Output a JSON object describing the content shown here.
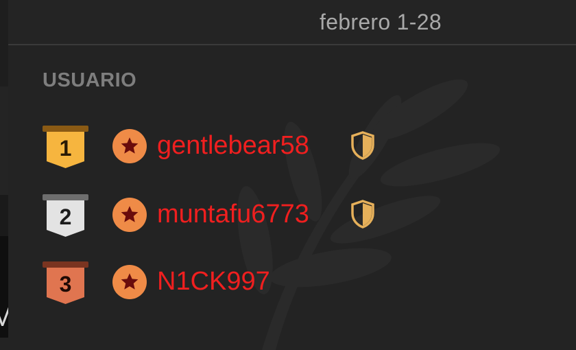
{
  "header": {
    "period": "febrero 1-28"
  },
  "table": {
    "column_header": "USUARIO",
    "rows": [
      {
        "rank": "1",
        "rank_color": "#f6b53f",
        "rank_top": "#8a5a14",
        "rank_text": "#2a1a05",
        "username": "gentlebear58",
        "moderator": true
      },
      {
        "rank": "2",
        "rank_color": "#e3e3e3",
        "rank_top": "#6e6e6e",
        "rank_text": "#1c1c1c",
        "username": "muntafu6773",
        "moderator": true
      },
      {
        "rank": "3",
        "rank_color": "#e07550",
        "rank_top": "#7a3420",
        "rank_text": "#1f0a05",
        "username": "N1CK997",
        "moderator": false
      }
    ]
  },
  "colors": {
    "background": "#232323",
    "username": "#f01f1f",
    "avatar_bg": "#ef8b47",
    "avatar_star": "#6a0c0c",
    "shield": "#e6b05a",
    "header_text": "#a9a9a9",
    "column_text": "#7e7e7e"
  },
  "icons": {
    "avatar": "star-avatar-icon",
    "moderator": "shield-icon",
    "rank": "rank-ribbon-icon"
  },
  "edge_text": "M"
}
